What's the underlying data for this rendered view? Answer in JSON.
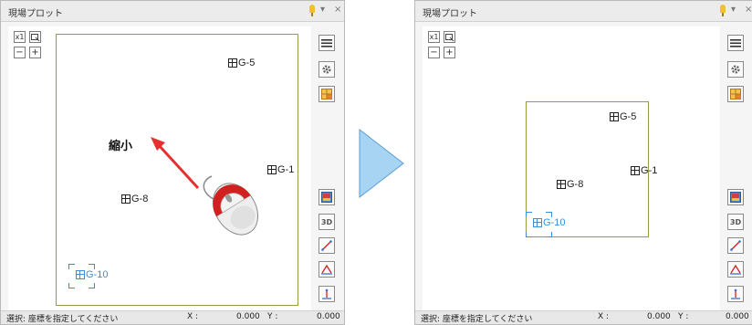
{
  "panel": {
    "title": "現場プロット",
    "pin_icon": "pin-icon",
    "menu_glyph": "▾",
    "close_glyph": "×"
  },
  "toolbar": {
    "fit_label": "x1",
    "zoom_out_label": "−",
    "zoom_in_label": "+"
  },
  "side_buttons": [
    {
      "icon": "list-menu-icon"
    },
    {
      "icon": "gear-icon"
    },
    {
      "icon": "grid-view-icon"
    },
    {
      "icon": "photo-icon"
    },
    {
      "icon": "3d-icon",
      "label": "3D"
    },
    {
      "icon": "line-measure-icon"
    },
    {
      "icon": "angle-measure-icon"
    },
    {
      "icon": "height-measure-icon"
    }
  ],
  "points": {
    "g5": "G-5",
    "g1": "G-1",
    "g8": "G-8",
    "g10": "G-10"
  },
  "annotation": {
    "shrink_label": "縮小"
  },
  "status": {
    "prompt": "選択: 座標を指定してください",
    "x_label": "X :",
    "x_value": "0.000",
    "y_label": "Y :",
    "y_value": "0.000"
  },
  "colors": {
    "selected": "#3a8fd8",
    "plot_border": "#9a9a40",
    "arrow": "#e53030",
    "transition_arrow": "#a7d4f2"
  }
}
